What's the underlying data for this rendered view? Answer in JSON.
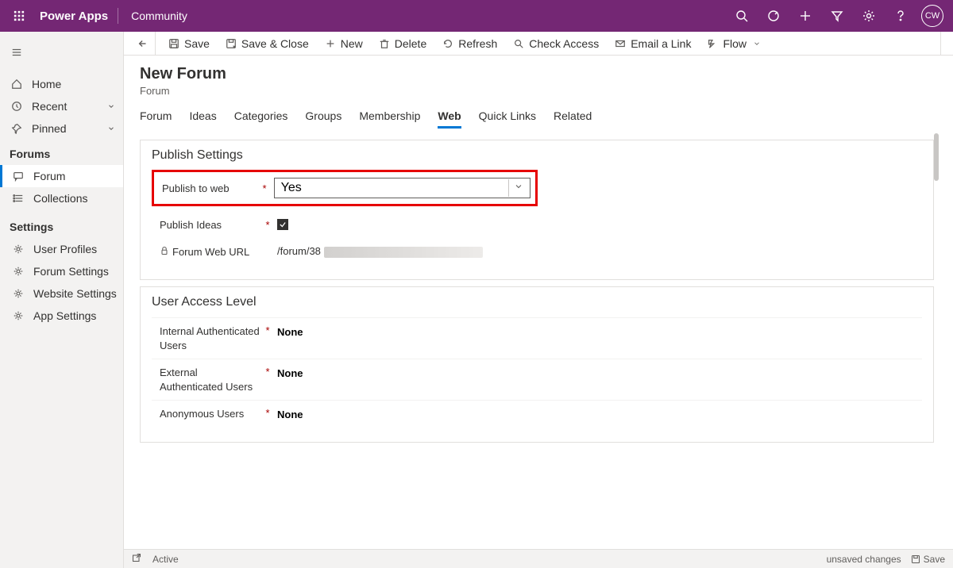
{
  "topbar": {
    "product": "Power Apps",
    "environment": "Community",
    "avatar_initials": "CW"
  },
  "sidebar": {
    "nav": {
      "home": "Home",
      "recent": "Recent",
      "pinned": "Pinned"
    },
    "group1_heading": "Forums",
    "group1": {
      "forum": "Forum",
      "collections": "Collections"
    },
    "group2_heading": "Settings",
    "group2": {
      "user_profiles": "User Profiles",
      "forum_settings": "Forum Settings",
      "website_settings": "Website Settings",
      "app_settings": "App Settings"
    }
  },
  "commands": {
    "save": "Save",
    "save_close": "Save & Close",
    "new": "New",
    "delete": "Delete",
    "refresh": "Refresh",
    "check_access": "Check Access",
    "email_link": "Email a Link",
    "flow": "Flow"
  },
  "page": {
    "title": "New Forum",
    "subtitle": "Forum"
  },
  "tabs": {
    "forum": "Forum",
    "ideas": "Ideas",
    "categories": "Categories",
    "groups": "Groups",
    "membership": "Membership",
    "web": "Web",
    "quick_links": "Quick Links",
    "related": "Related"
  },
  "publish_section": {
    "heading": "Publish Settings",
    "publish_to_web_label": "Publish to web",
    "publish_to_web_value": "Yes",
    "publish_ideas_label": "Publish Ideas",
    "publish_ideas_checked": true,
    "forum_url_label": "Forum Web URL",
    "forum_url_value": "/forum/38"
  },
  "access_section": {
    "heading": "User Access Level",
    "internal_label": "Internal Authenticated Users",
    "internal_value": "None",
    "external_label": "External Authenticated Users",
    "external_value": "None",
    "anonymous_label": "Anonymous Users",
    "anonymous_value": "None"
  },
  "statusbar": {
    "status": "Active",
    "unsaved": "unsaved changes",
    "save": "Save"
  }
}
